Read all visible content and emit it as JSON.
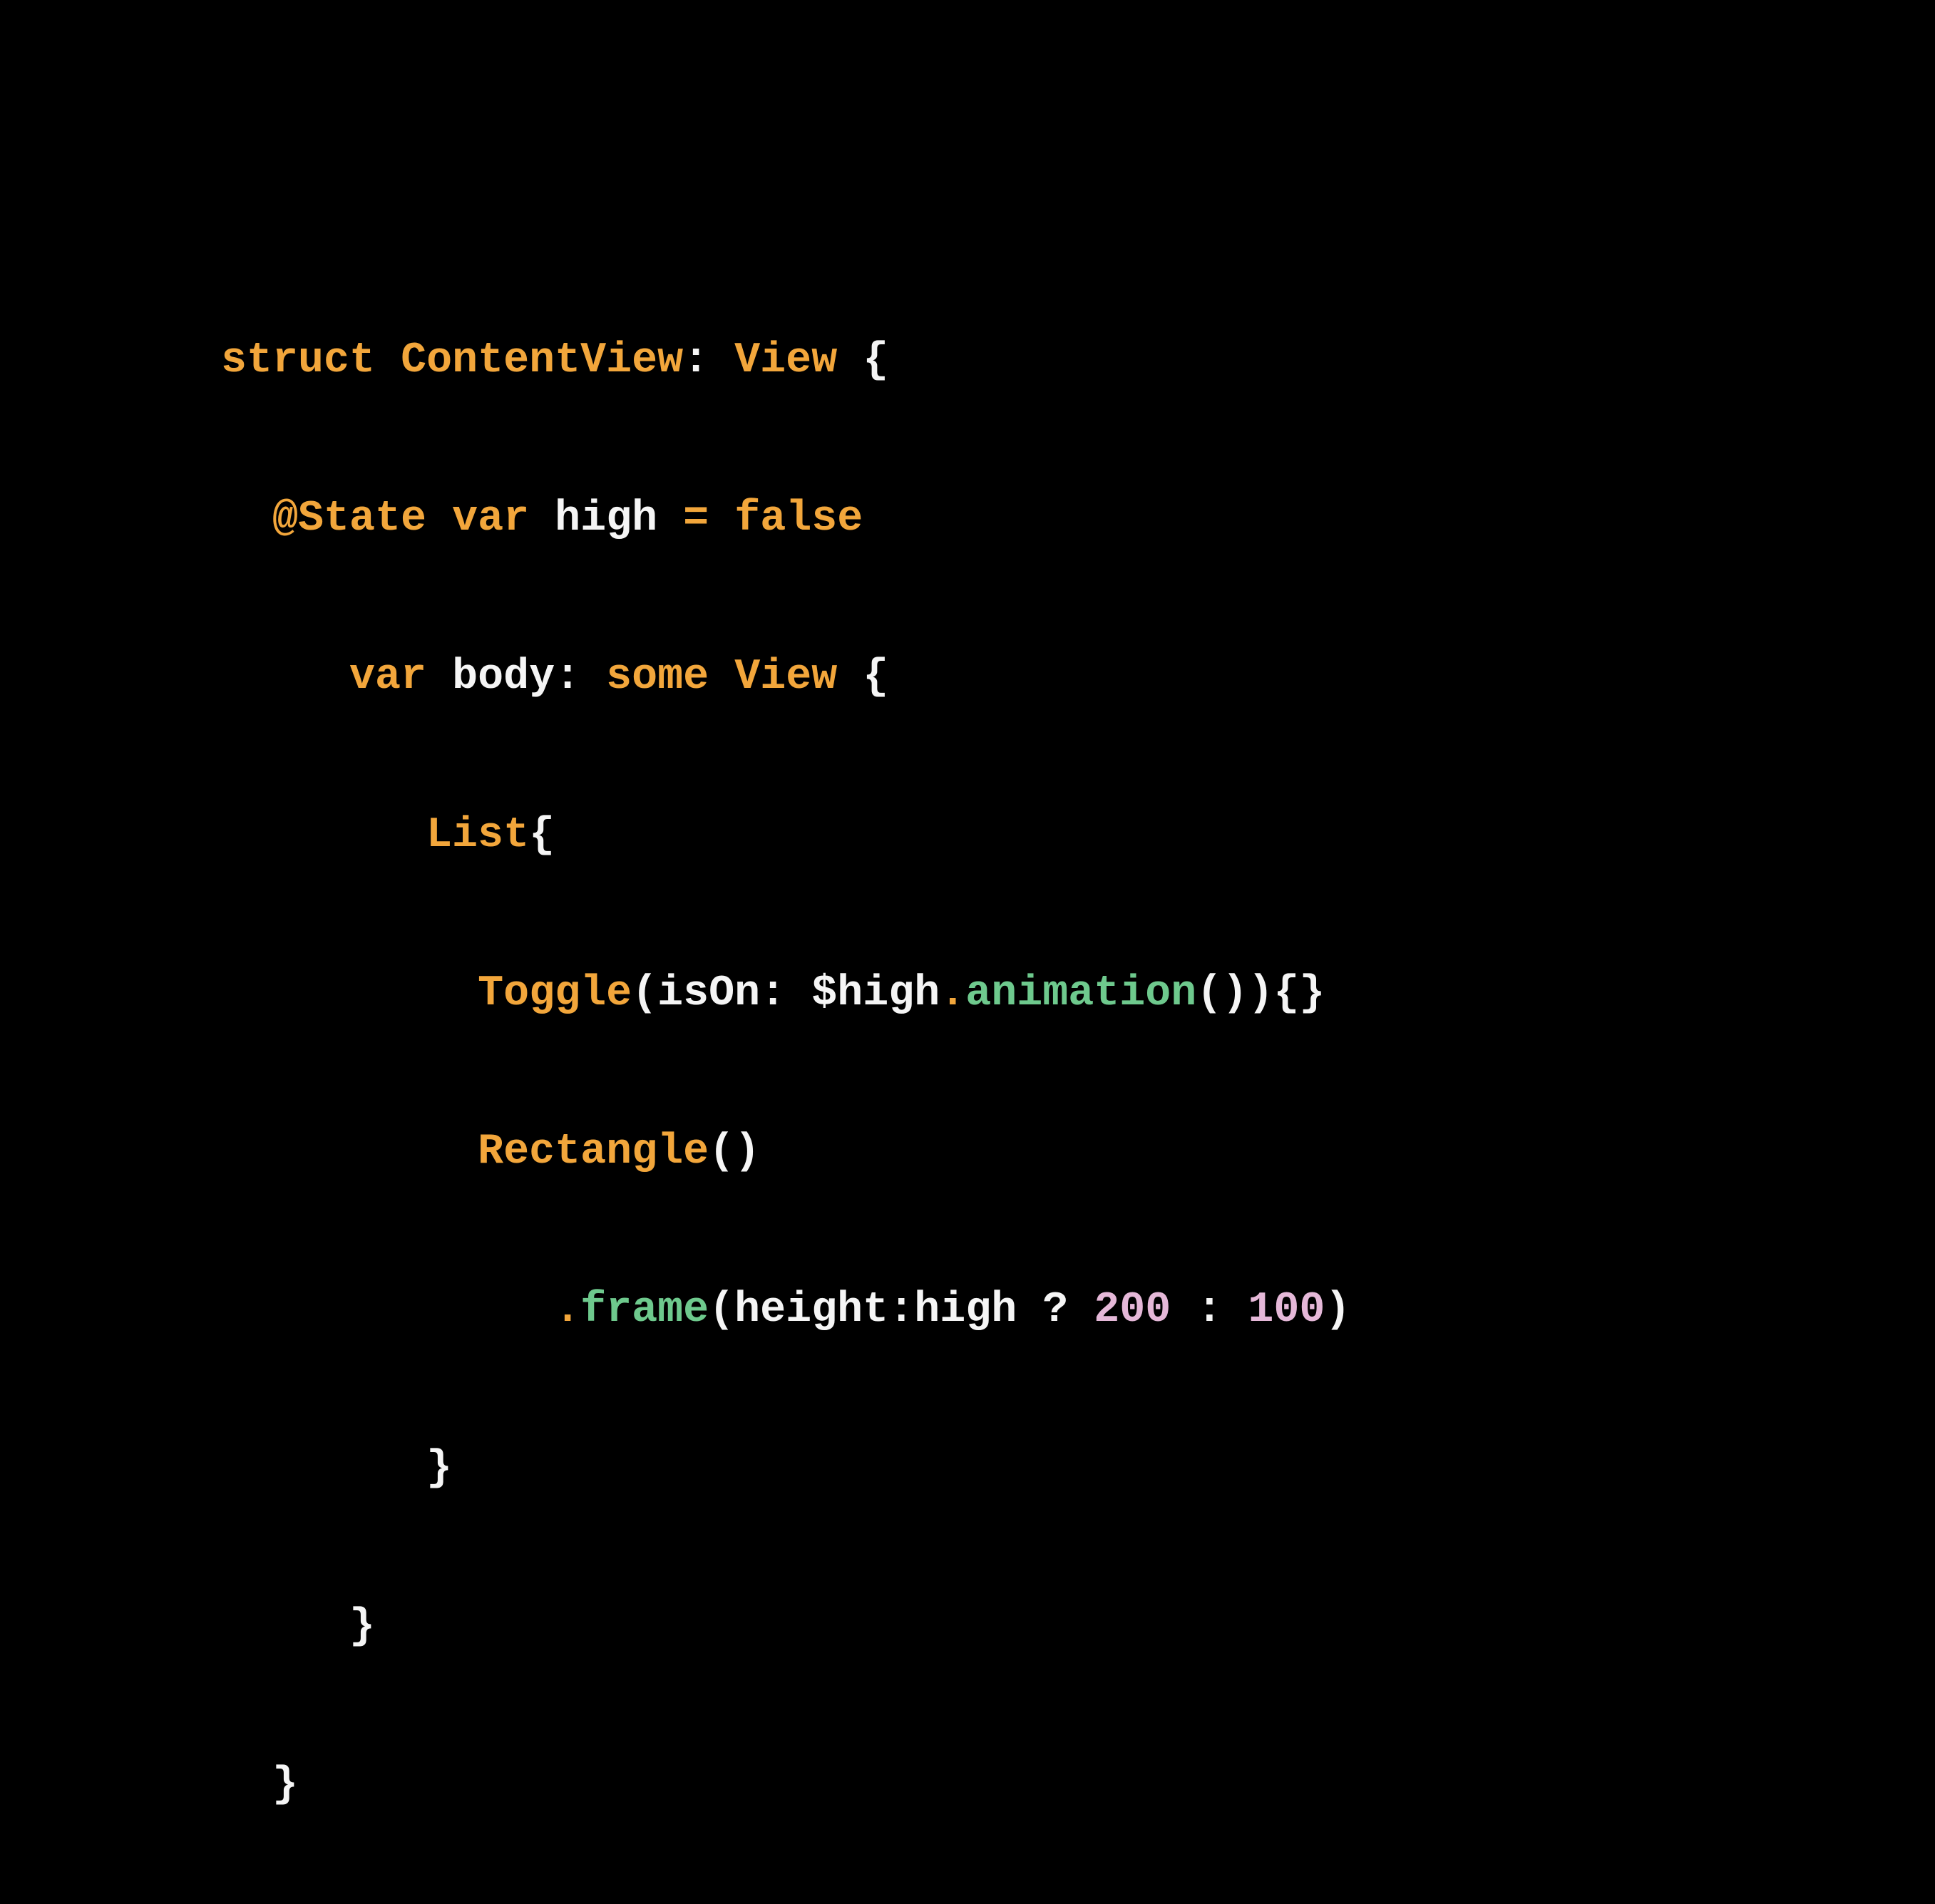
{
  "code": {
    "line1": {
      "struct": "struct",
      "name": "ContentView",
      "colon": ":",
      "protocol": "View",
      "brace": "{"
    },
    "line2": {
      "attr": "@State",
      "var": "var",
      "name": "high",
      "equals": "=",
      "value": "false"
    },
    "line3": {
      "var": "var",
      "name": "body",
      "colon": ":",
      "some": "some",
      "type": "View",
      "brace": "{"
    },
    "line4": {
      "list": "List",
      "brace": "{"
    },
    "line5": {
      "toggle": "Toggle",
      "open": "(",
      "param": "isOn",
      "colon": ":",
      "binding": "$high",
      "dot": ".",
      "method": "animation",
      "parens": "()",
      "close": ")",
      "braces": "{}"
    },
    "line6": {
      "rect": "Rectangle",
      "parens": "()"
    },
    "line7": {
      "dot": ".",
      "method": "frame",
      "open": "(",
      "param": "height",
      "colon": ":",
      "cond": "high",
      "ternary": "?",
      "val1": "200",
      "colon2": ":",
      "val2": "100",
      "close": ")"
    },
    "line8": {
      "brace": "}"
    },
    "line9": {
      "brace": "}"
    },
    "line10": {
      "brace": "}"
    }
  }
}
